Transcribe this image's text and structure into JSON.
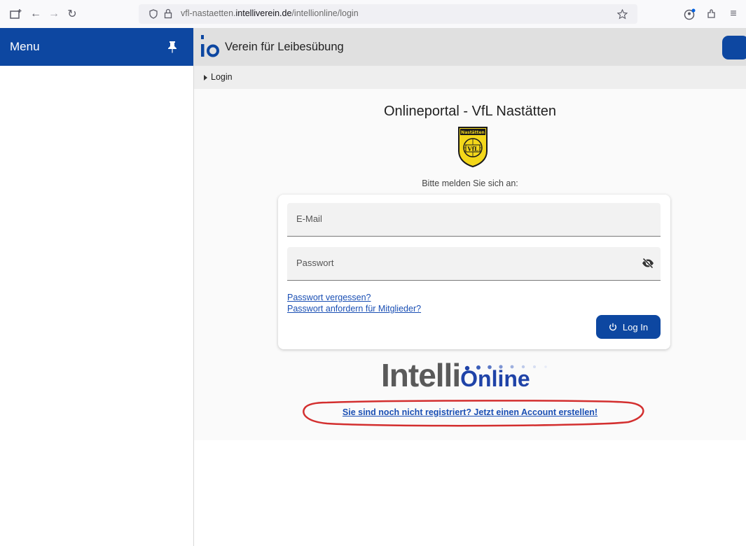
{
  "browser": {
    "url_prefix": "vfl-nastaetten.",
    "url_domain": "intelliverein.de",
    "url_path": "/intellionline/login"
  },
  "sidebar": {
    "title": "Menu"
  },
  "header": {
    "logo_text": "io",
    "title": "Verein für Leibesübung"
  },
  "breadcrumb": {
    "current": "Login"
  },
  "main": {
    "portal_title": "Onlineportal - VfL Nastätten",
    "crest_top_text": "Nastätten",
    "crest_text": "VfL",
    "prompt": "Bitte melden Sie sich an:",
    "email_label": "E-Mail",
    "password_label": "Passwort",
    "forgot_link": "Passwort vergessen?",
    "request_link": "Passwort anfordern für Mitglieder?",
    "login_label": "Log In",
    "brand_word1": "Intelli",
    "brand_word2": "Online",
    "register_link": "Sie sind noch nicht registriert? Jetzt einen Account erstellen!"
  },
  "colors": {
    "primary": "#0d47a1",
    "link": "#1a4fb4",
    "annotation": "#d32f2f"
  }
}
